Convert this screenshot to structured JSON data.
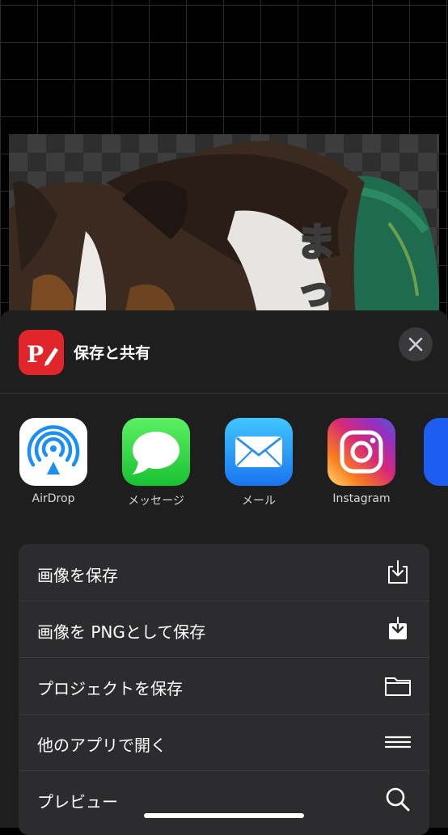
{
  "canvas": {
    "sticker_text": "まっ"
  },
  "sheet": {
    "title": "保存と共有",
    "app_icon_letter": "P",
    "share_targets": [
      {
        "label": "AirDrop",
        "icon": "airdrop-icon"
      },
      {
        "label": "メッセージ",
        "icon": "messages-icon"
      },
      {
        "label": "メール",
        "icon": "mail-icon"
      },
      {
        "label": "Instagram",
        "icon": "instagram-icon"
      }
    ],
    "actions": [
      {
        "label": "画像を保存",
        "icon": "save-download-icon"
      },
      {
        "label": "画像を PNGとして保存",
        "icon": "save-png-icon"
      },
      {
        "label": "プロジェクトを保存",
        "icon": "folder-icon"
      },
      {
        "label": "他のアプリで開く",
        "icon": "menu-lines-icon"
      },
      {
        "label": "プレビュー",
        "icon": "magnifier-icon"
      }
    ]
  },
  "colors": {
    "app_accent": "#e0252b",
    "sheet_bg": "#1e1e1f",
    "list_bg": "#2c2c2e"
  }
}
